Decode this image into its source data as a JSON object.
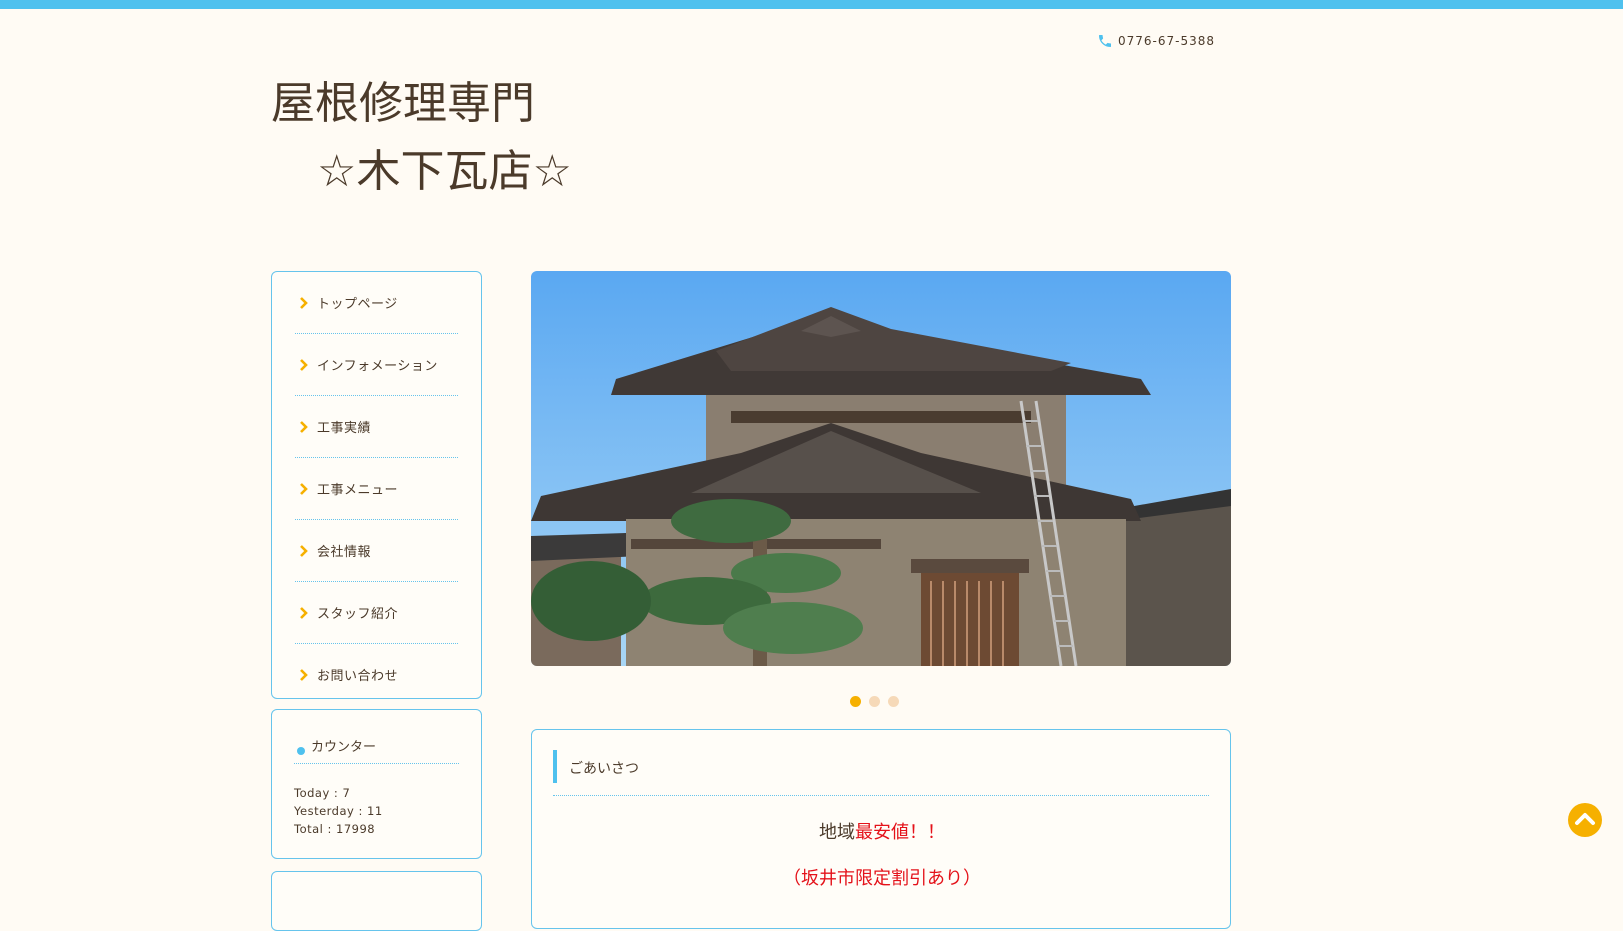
{
  "header": {
    "phone": "0776-67-5388",
    "title_line1": "屋根修理専門",
    "title_line2": "☆木下瓦店☆"
  },
  "nav": {
    "items": [
      {
        "label": "トップページ"
      },
      {
        "label": "インフォメーション"
      },
      {
        "label": "工事実績"
      },
      {
        "label": "工事メニュー"
      },
      {
        "label": "会社情報"
      },
      {
        "label": "スタッフ紹介"
      },
      {
        "label": "お問い合わせ"
      }
    ]
  },
  "counter": {
    "heading": "カウンター",
    "today": "Today : 7",
    "yesterday": "Yesterday : 11",
    "total": "Total : 17998"
  },
  "slider": {
    "image_name": "traditional-japanese-house-photo",
    "active_index": 0,
    "dot_count": 3
  },
  "greeting": {
    "heading": "ごあいさつ",
    "line1_prefix": "地域",
    "line1_highlight": "最安値！！",
    "line2": "（坂井市限定割引あり）"
  },
  "colors": {
    "accent": "#4fc1ee",
    "highlight": "#e4121a",
    "chevron": "#f6b000",
    "background": "#fffbf4"
  }
}
